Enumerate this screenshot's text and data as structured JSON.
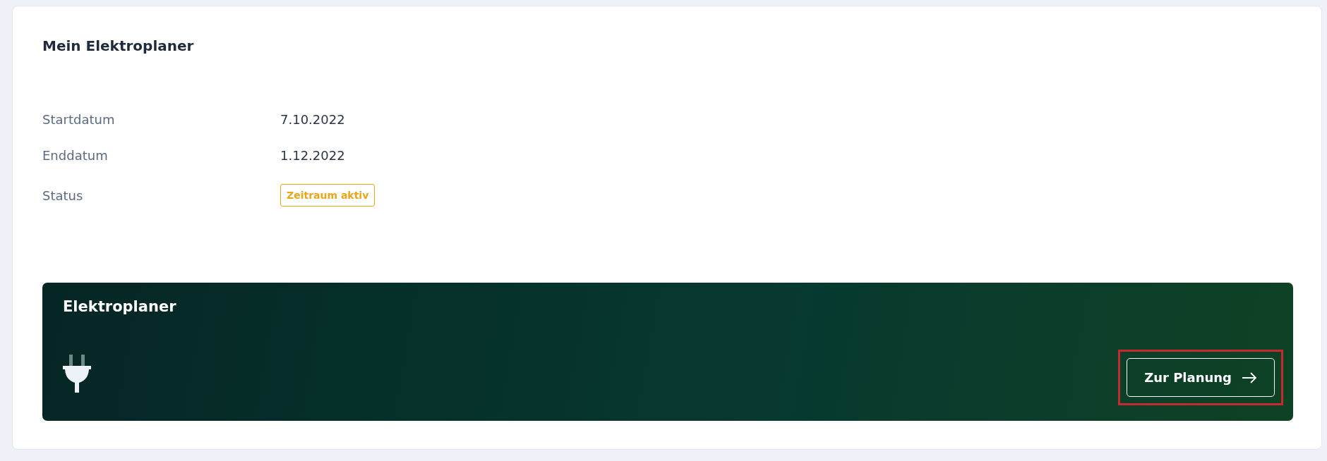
{
  "card": {
    "title": "Mein Elektroplaner",
    "fields": [
      {
        "label": "Startdatum",
        "value": "7.10.2022",
        "kind": "text"
      },
      {
        "label": "Enddatum",
        "value": "1.12.2022",
        "kind": "text"
      },
      {
        "label": "Status",
        "value": "Zeitraum aktiv",
        "kind": "badge"
      }
    ]
  },
  "banner": {
    "title": "Elektroplaner",
    "button": {
      "label": "Zur Planung",
      "highlighted": true
    }
  }
}
